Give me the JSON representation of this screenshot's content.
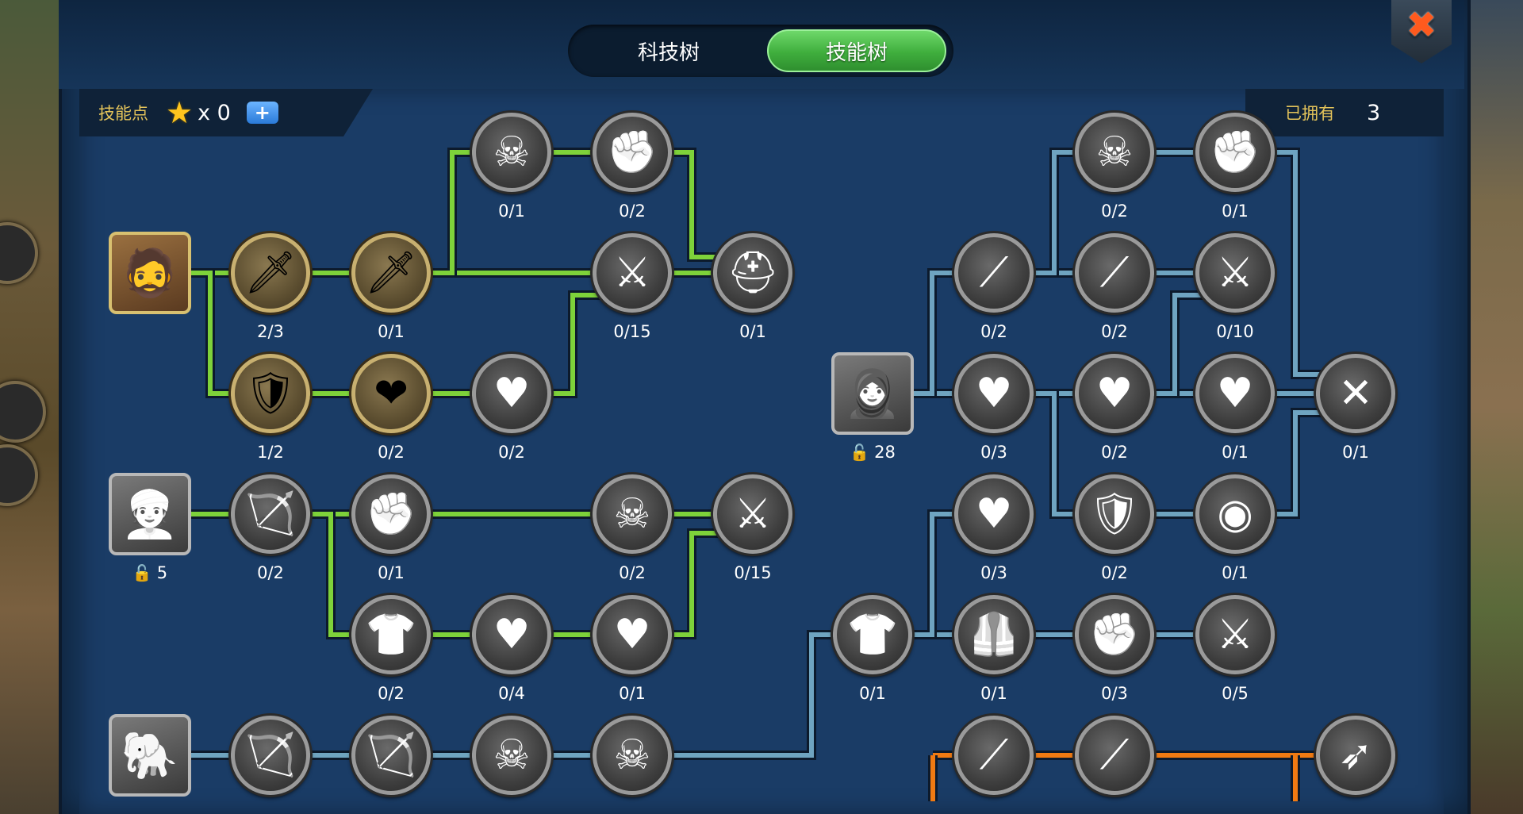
{
  "tabs": {
    "tech": "科技树",
    "skill": "技能树"
  },
  "close_icon": "close-icon",
  "skill_points": {
    "label": "技能点",
    "icon": "star-icon",
    "value": "x 0",
    "add": "+"
  },
  "owned": {
    "label": "已拥有",
    "value": "3"
  },
  "colors": {
    "active_link": "#7ed23a",
    "blue_link": "#6fa4c0",
    "orange_link": "#f07a12",
    "selected_tab": "#3fae3d"
  },
  "nodes": [
    {
      "id": "swordsman-hero",
      "type": "hero",
      "icon": "swordsman-portrait",
      "glyph": "🧔",
      "label": ""
    },
    {
      "id": "sword1",
      "icon": "sword-icon",
      "glyph": "🗡",
      "label": "2/3",
      "state": "active"
    },
    {
      "id": "sword2",
      "icon": "sword-icon",
      "glyph": "🗡",
      "label": "0/1",
      "state": "active"
    },
    {
      "id": "skull1",
      "icon": "skull-icon",
      "glyph": "☠",
      "label": "0/1",
      "state": "locked"
    },
    {
      "id": "fist1",
      "icon": "fist-icon",
      "glyph": "✊",
      "label": "0/2",
      "state": "locked"
    },
    {
      "id": "troops1",
      "icon": "troops-icon",
      "glyph": "⚔",
      "label": "0/15",
      "state": "locked"
    },
    {
      "id": "warrior1",
      "icon": "warrior-icon",
      "glyph": "⛑",
      "label": "0/1",
      "state": "locked"
    },
    {
      "id": "shield1",
      "icon": "shield-icon",
      "glyph": "🛡",
      "label": "1/2",
      "state": "active"
    },
    {
      "id": "heart1",
      "icon": "heart-icon",
      "glyph": "❤",
      "label": "0/2",
      "state": "active"
    },
    {
      "id": "heart-spiked1",
      "icon": "spiked-heart-icon",
      "glyph": "♥",
      "label": "0/2",
      "state": "locked"
    },
    {
      "id": "archer-hero",
      "type": "hero",
      "icon": "archer-portrait",
      "glyph": "👳",
      "unlock": "5"
    },
    {
      "id": "bow1",
      "icon": "bow-icon",
      "glyph": "🏹",
      "label": "0/2",
      "state": "locked"
    },
    {
      "id": "fist2",
      "icon": "fist-icon",
      "glyph": "✊",
      "label": "0/1",
      "state": "locked"
    },
    {
      "id": "skull2",
      "icon": "skull-icon",
      "glyph": "☠",
      "label": "0/2",
      "state": "locked"
    },
    {
      "id": "troops2",
      "icon": "troops-icon",
      "glyph": "⚔",
      "label": "0/15",
      "state": "locked"
    },
    {
      "id": "armor1",
      "icon": "armor-icon",
      "glyph": "👕",
      "label": "0/2",
      "state": "locked"
    },
    {
      "id": "heart2",
      "icon": "heart-icon",
      "glyph": "♥",
      "label": "0/4",
      "state": "locked"
    },
    {
      "id": "heart-spiked2",
      "icon": "spiked-heart-icon",
      "glyph": "♥",
      "label": "0/1",
      "state": "locked"
    },
    {
      "id": "elephant-hero",
      "type": "hero",
      "icon": "elephant-portrait",
      "glyph": "🐘"
    },
    {
      "id": "bow2",
      "icon": "bow-icon",
      "glyph": "🏹",
      "state": "locked"
    },
    {
      "id": "bow3",
      "icon": "bow-icon",
      "glyph": "🏹",
      "state": "locked"
    },
    {
      "id": "skull3",
      "icon": "skull-icon",
      "glyph": "☠",
      "state": "locked"
    },
    {
      "id": "skull-horned",
      "icon": "horned-skull-icon",
      "glyph": "☠",
      "state": "locked"
    },
    {
      "id": "spear-hero",
      "type": "hero",
      "icon": "spearman-portrait",
      "glyph": "🧕",
      "unlock": "28"
    },
    {
      "id": "skull4",
      "icon": "skull-icon",
      "glyph": "☠",
      "label": "0/2",
      "state": "locked"
    },
    {
      "id": "fist3",
      "icon": "fist-icon",
      "glyph": "✊",
      "label": "0/1",
      "state": "locked"
    },
    {
      "id": "spear1",
      "icon": "spear-icon",
      "glyph": "⟋",
      "label": "0/2",
      "state": "locked"
    },
    {
      "id": "spear2",
      "icon": "spear-icon",
      "glyph": "⟋",
      "label": "0/2",
      "state": "locked"
    },
    {
      "id": "troops3",
      "icon": "troops-icon",
      "glyph": "⚔",
      "label": "0/10",
      "state": "locked"
    },
    {
      "id": "heart3",
      "icon": "heart-icon",
      "glyph": "♥",
      "label": "0/3",
      "state": "locked"
    },
    {
      "id": "heart-spiked3",
      "icon": "spiked-heart-icon",
      "glyph": "♥",
      "label": "0/2",
      "state": "locked"
    },
    {
      "id": "heart-winged1",
      "icon": "winged-heart-icon",
      "glyph": "♥",
      "label": "0/1",
      "state": "locked"
    },
    {
      "id": "slash1",
      "icon": "slash-icon",
      "glyph": "✕",
      "label": "0/1",
      "state": "locked"
    },
    {
      "id": "heart-winged2",
      "icon": "winged-heart-icon",
      "glyph": "♥",
      "label": "0/3",
      "state": "locked"
    },
    {
      "id": "shield2",
      "icon": "shield-icon",
      "glyph": "🛡",
      "label": "0/2",
      "state": "locked"
    },
    {
      "id": "shield3",
      "icon": "round-shield-icon",
      "glyph": "◉",
      "label": "0/1",
      "state": "locked"
    },
    {
      "id": "armor2",
      "icon": "armor-icon",
      "glyph": "👕",
      "label": "0/1",
      "state": "locked"
    },
    {
      "id": "armor3",
      "icon": "plate-armor-icon",
      "glyph": "🦺",
      "label": "0/1",
      "state": "locked"
    },
    {
      "id": "fist4",
      "icon": "fist-icon",
      "glyph": "✊",
      "label": "0/3",
      "state": "locked"
    },
    {
      "id": "troops4",
      "icon": "troops-icon",
      "glyph": "⚔",
      "label": "0/5",
      "state": "locked"
    },
    {
      "id": "spear3",
      "icon": "spear-icon",
      "glyph": "⟋",
      "state": "locked"
    },
    {
      "id": "spear4",
      "icon": "spear-icon",
      "glyph": "⟋",
      "state": "locked"
    },
    {
      "id": "arrow1",
      "icon": "arrow-icon",
      "glyph": "➶",
      "state": "locked"
    }
  ]
}
